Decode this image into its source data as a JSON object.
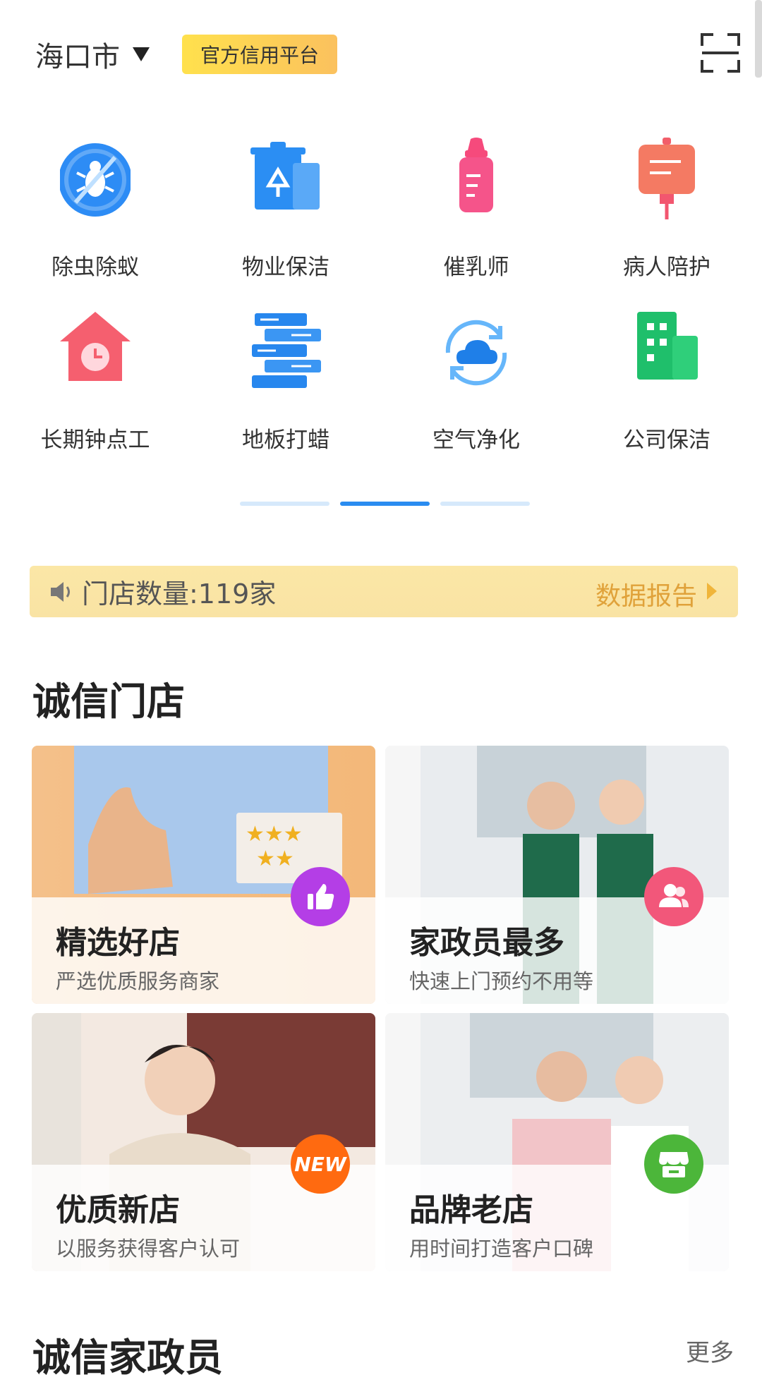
{
  "header": {
    "city": "海口市",
    "badge": "官方信用平台"
  },
  "services": [
    {
      "label": "除虫除蚁",
      "icon": "bug-icon"
    },
    {
      "label": "物业保洁",
      "icon": "trash-bin-icon"
    },
    {
      "label": "催乳师",
      "icon": "baby-bottle-icon"
    },
    {
      "label": "病人陪护",
      "icon": "iv-drip-icon"
    },
    {
      "label": "长期钟点工",
      "icon": "house-clock-icon"
    },
    {
      "label": "地板打蜡",
      "icon": "floor-boards-icon"
    },
    {
      "label": "空气净化",
      "icon": "cloud-refresh-icon"
    },
    {
      "label": "公司保洁",
      "icon": "building-icon"
    }
  ],
  "pager": {
    "pages": 3,
    "active": 2
  },
  "notice": {
    "text": "门店数量:119家",
    "report": "数据报告"
  },
  "section1": {
    "title": "诚信门店",
    "cards": [
      {
        "title": "精选好店",
        "subtitle": "严选优质服务商家",
        "icon": "thumbs-up-icon",
        "color": "#b43ee6"
      },
      {
        "title": "家政员最多",
        "subtitle": "快速上门预约不用等",
        "icon": "users-icon",
        "color": "#f2577a"
      },
      {
        "title": "优质新店",
        "subtitle": "以服务获得客户认可",
        "icon": "new-badge-icon",
        "color": "#ff6a10",
        "badge_text": "NEW"
      },
      {
        "title": "品牌老店",
        "subtitle": "用时间打造客户口碑",
        "icon": "shop-icon",
        "color": "#4cb63a"
      }
    ]
  },
  "section2": {
    "title": "诚信家政员",
    "more": "更多"
  },
  "colors": {
    "accent": "#2a8cf0",
    "notice_bg": "#fbe7a6",
    "notice_link": "#e0a23a"
  }
}
